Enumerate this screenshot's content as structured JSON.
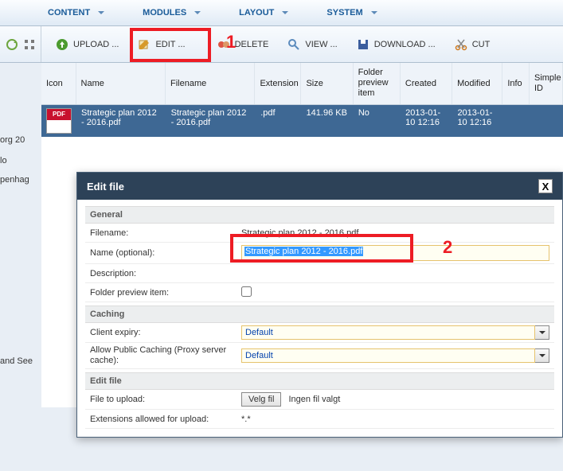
{
  "menubar": {
    "items": [
      {
        "label": "CONTENT"
      },
      {
        "label": "MODULES"
      },
      {
        "label": "LAYOUT"
      },
      {
        "label": "SYSTEM"
      }
    ]
  },
  "toolbar": {
    "upload": "UPLOAD ...",
    "edit": "EDIT ...",
    "delete": "DELETE",
    "view": "VIEW ...",
    "download": "DOWNLOAD ...",
    "cut": "CUT"
  },
  "grid": {
    "headers": {
      "icon": "Icon",
      "name": "Name",
      "filename": "Filename",
      "extension": "Extension",
      "size": "Size",
      "folder": "Folder preview item",
      "created": "Created",
      "modified": "Modified",
      "info": "Info",
      "id": "Simple ID"
    },
    "rows": [
      {
        "icon_label": "PDF",
        "name": "Strategic plan 2012 - 2016.pdf",
        "filename": "Strategic plan 2012 - 2016.pdf",
        "extension": ".pdf",
        "size": "141.96 KB",
        "folder": "No",
        "created": "2013-01-10 12:16",
        "modified": "2013-01-10 12:16"
      }
    ]
  },
  "sidebar_fragments": {
    "a": "org 20",
    "b": "lo",
    "c": "penhag",
    "d": "and See"
  },
  "annotations": {
    "one": "1",
    "two": "2"
  },
  "dialog": {
    "title": "Edit file",
    "sections": {
      "general": "General",
      "caching": "Caching",
      "editfile": "Edit file"
    },
    "general": {
      "filename_label": "Filename:",
      "filename_value": "Strategic plan 2012 - 2016.pdf",
      "name_label": "Name (optional):",
      "name_value": "Strategic plan 2012 - 2016.pdf",
      "description_label": "Description:",
      "description_value": "",
      "folderpreview_label": "Folder preview item:"
    },
    "caching": {
      "clientexpiry_label": "Client expiry:",
      "clientexpiry_value": "Default",
      "allowpublic_label": "Allow Public Caching (Proxy server cache):",
      "allowpublic_value": "Default"
    },
    "editfile": {
      "upload_label": "File to upload:",
      "choose_button": "Velg fil",
      "nofile_text": "Ingen fil valgt",
      "ext_label": "Extensions allowed for upload:",
      "ext_value": "*.*"
    }
  }
}
